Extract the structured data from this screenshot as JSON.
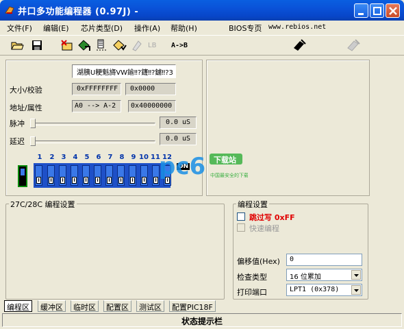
{
  "window": {
    "title": "并口多功能编程器 (0.97J) -",
    "icon": "programmer-app-icon"
  },
  "menu": {
    "items": [
      "文件(F)",
      "编辑(E)",
      "芯片类型(D)",
      "操作(A)",
      "帮助(H)",
      "BIOS专页"
    ],
    "website": "www.rebios.net"
  },
  "toolbar": {
    "lb_label": "LB",
    "copy_label": "A->B"
  },
  "chip_panel": {
    "chip_name": "湖胰U粳魁旖VW鍮‼?鑳‼?鑢‼?3",
    "size_label": "大小/校验",
    "size_value": "0xFFFFFFFF",
    "checksum_value": "0x0000",
    "address_label": "地址/属性",
    "address_value": "A0 --> A-2",
    "attribute_value": "0x40000000",
    "pulse_label": "脉冲",
    "pulse_value": "0.0 uS",
    "delay_label": "延迟",
    "delay_value": "0.0 uS"
  },
  "dip_switch": {
    "numbers": [
      "1",
      "2",
      "3",
      "4",
      "5",
      "6",
      "7",
      "8",
      "9",
      "10",
      "11",
      "12"
    ],
    "switch_label": "I",
    "on_label": "ON"
  },
  "left_group": {
    "title": "27C/28C 编程设置"
  },
  "right_group": {
    "title": "编程设置",
    "skip_write_label": "跳过写 0xFF",
    "fast_program_label": "快速编程",
    "offset_label": "偏移值(Hex)",
    "offset_value": "0",
    "check_type_label": "检查类型",
    "check_type_value": "16 位累加",
    "port_label": "打印端口",
    "port_value": "LPT1 (0x378)"
  },
  "tabs": [
    "编程区",
    "缓冲区",
    "临时区",
    "配置区",
    "测试区",
    "配置PIC18F"
  ],
  "active_tab": 0,
  "status_text": "状态提示栏",
  "watermark": {
    "brand": "pc6",
    "subtitle": "下载站",
    "tagline": "中国最安全的下载站"
  },
  "colors": {
    "titlebar": "#0a52d8",
    "dip_block": "#1e50c8",
    "skip_write_red": "#e00000",
    "watermark_blue": "#1a8fe6",
    "watermark_green": "#3cb043"
  }
}
